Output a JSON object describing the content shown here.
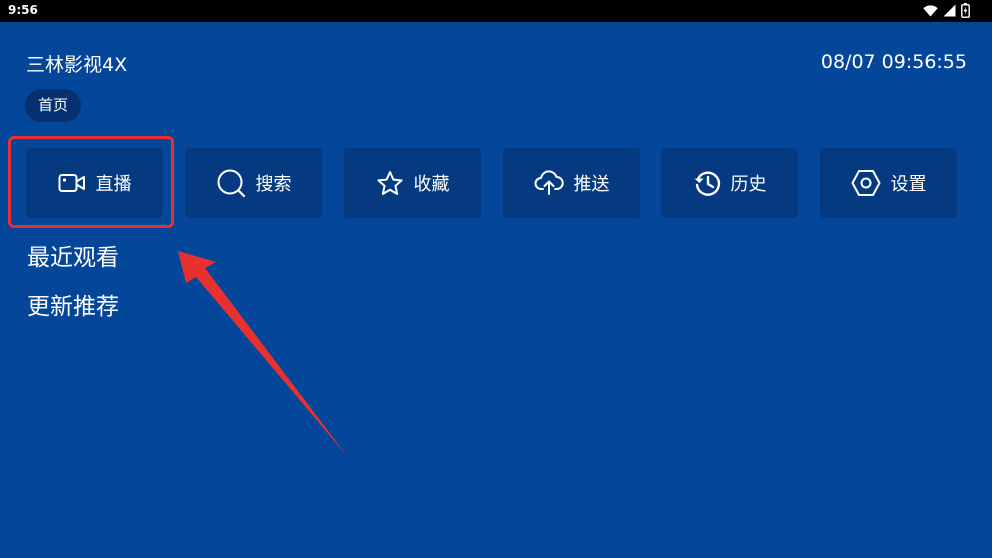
{
  "status_bar": {
    "time": "9:56",
    "icons": [
      "wifi-icon",
      "signal-icon",
      "battery-icon"
    ]
  },
  "header": {
    "app_title": "三林影视4X",
    "datetime": "08/07 09:56:55"
  },
  "tabs": {
    "home_label": "首页"
  },
  "nav": [
    {
      "label": "直播",
      "icon": "video-camera-icon"
    },
    {
      "label": "搜索",
      "icon": "search-icon"
    },
    {
      "label": "收藏",
      "icon": "star-icon"
    },
    {
      "label": "推送",
      "icon": "cloud-upload-icon"
    },
    {
      "label": "历史",
      "icon": "history-icon"
    },
    {
      "label": "设置",
      "icon": "settings-hexagon-icon"
    }
  ],
  "sections": {
    "recent_label": "最近观看",
    "recommend_label": "更新推荐"
  },
  "colors": {
    "background": "#04469a",
    "button": "#063a80",
    "pill": "#06306f",
    "annotation": "#e8302f"
  }
}
